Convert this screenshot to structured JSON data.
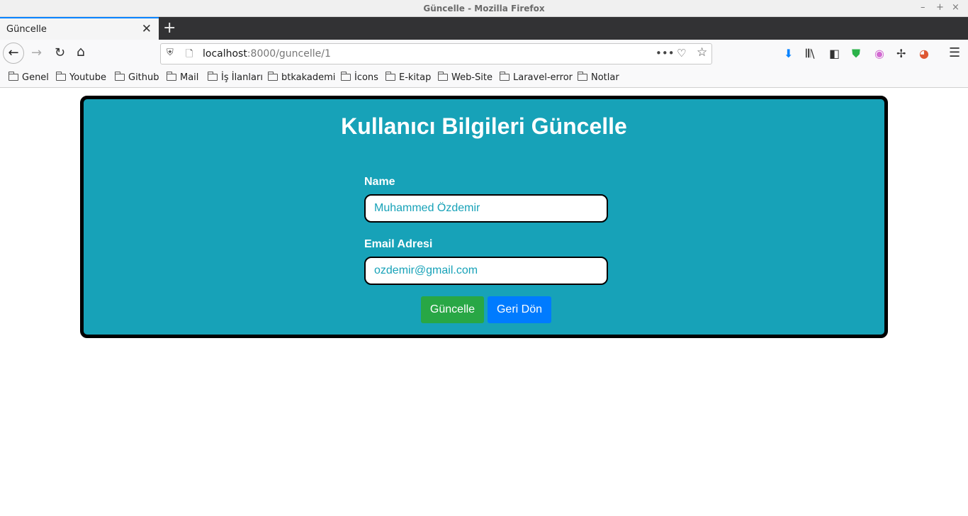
{
  "window": {
    "title": "Güncelle - Mozilla Firefox",
    "controls": {
      "minimize": "–",
      "maximize": "+",
      "close": "×"
    }
  },
  "tab": {
    "label": "Güncelle",
    "close": "✕",
    "new_tab": "+"
  },
  "url": {
    "host": "localhost",
    "path": ":8000/guncelle/1"
  },
  "bookmarks": [
    "Genel",
    "Youtube",
    "Github",
    "Mail",
    "İş İlanları",
    "btkakademi",
    "İcons",
    "E-kitap",
    "Web-Site",
    "Laravel-error",
    "Notlar"
  ],
  "form": {
    "title": "Kullanıcı Bilgileri Güncelle",
    "name_label": "Name",
    "name_value": "Muhammed Özdemir",
    "email_label": "Email Adresi",
    "email_value": "ozdemir@gmail.com",
    "submit_label": "Güncelle",
    "back_label": "Geri Dön"
  },
  "colors": {
    "card_bg": "#17a2b8",
    "success": "#28a745",
    "primary": "#007bff"
  }
}
